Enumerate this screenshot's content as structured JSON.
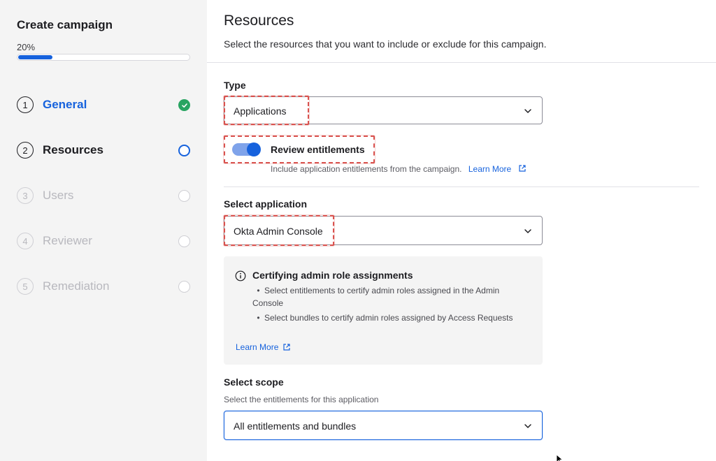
{
  "sidebar": {
    "title": "Create campaign",
    "progress_label": "20%",
    "progress": 0.2,
    "steps": [
      {
        "number": "1",
        "label": "General",
        "state": "done"
      },
      {
        "number": "2",
        "label": "Resources",
        "state": "current"
      },
      {
        "number": "3",
        "label": "Users",
        "state": "todo"
      },
      {
        "number": "4",
        "label": "Reviewer",
        "state": "todo"
      },
      {
        "number": "5",
        "label": "Remediation",
        "state": "todo"
      }
    ]
  },
  "main": {
    "heading": "Resources",
    "subheading": "Select the resources that you want to include or exclude for this campaign.",
    "type": {
      "label": "Type",
      "value": "Applications"
    },
    "review_entitlements": {
      "enabled": true,
      "label": "Review entitlements",
      "help": "Include application entitlements from the campaign.",
      "link": "Learn More"
    },
    "application": {
      "label": "Select application",
      "value": "Okta Admin Console"
    },
    "info": {
      "title": "Certifying admin role assignments",
      "items": [
        "Select entitlements to certify admin roles assigned in the Admin Console",
        "Select bundles to certify admin roles assigned by Access Requests"
      ],
      "link": "Learn More"
    },
    "scope": {
      "label": "Select scope",
      "help": "Select the entitlements for this application",
      "value": "All entitlements and bundles"
    }
  },
  "colors": {
    "accent": "#1662dd",
    "success": "#28a461",
    "highlight": "#d9534f",
    "sidebar_bg": "#f4f4f4"
  },
  "icons": {
    "done": "check-circle-icon",
    "current": "circle-outline-icon",
    "caret": "chevron-down-icon",
    "external": "external-link-icon",
    "info": "info-icon"
  }
}
